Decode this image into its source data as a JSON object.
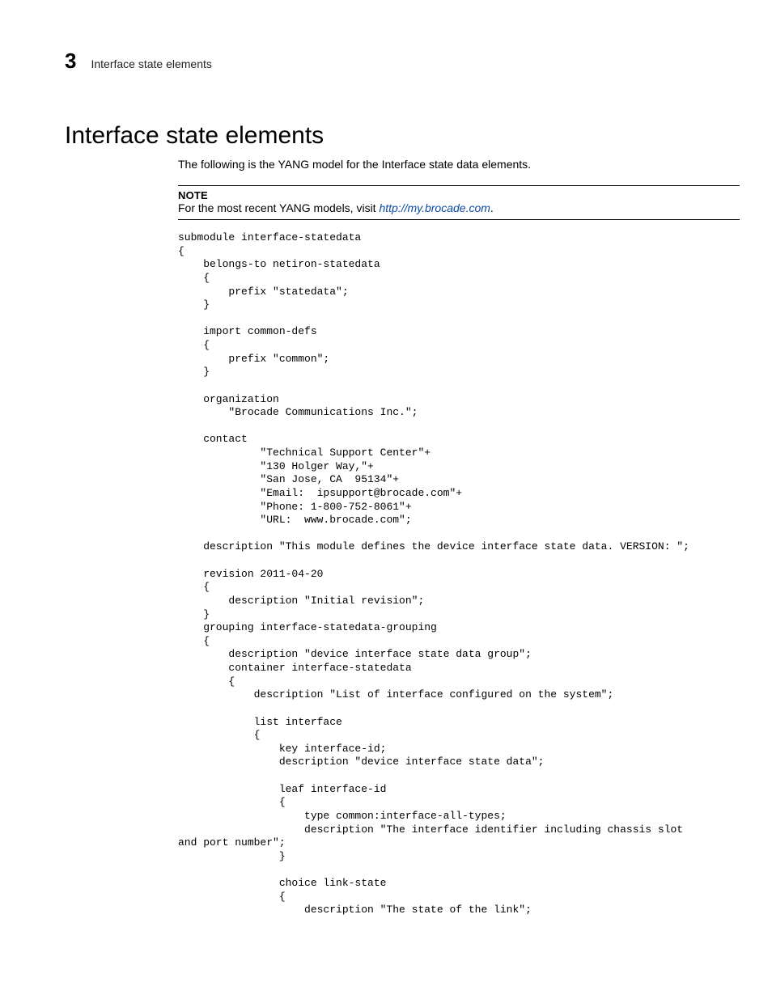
{
  "header": {
    "chapter_number": "3",
    "running_title": "Interface state elements"
  },
  "section": {
    "title": "Interface state elements",
    "intro": "The following is the YANG model for the Interface state data elements."
  },
  "note": {
    "label": "NOTE",
    "text_prefix": "For the most recent YANG models, visit ",
    "link_text": "http://my.brocade.com",
    "text_suffix": "."
  },
  "code": "submodule interface-statedata\n{\n    belongs-to netiron-statedata\n    {\n        prefix \"statedata\";\n    }\n\n    import common-defs\n    {\n        prefix \"common\";\n    }\n\n    organization\n        \"Brocade Communications Inc.\";\n\n    contact\n             \"Technical Support Center\"+\n             \"130 Holger Way,\"+\n             \"San Jose, CA  95134\"+\n             \"Email:  ipsupport@brocade.com\"+\n             \"Phone: 1-800-752-8061\"+\n             \"URL:  www.brocade.com\";\n\n    description \"This module defines the device interface state data. VERSION: \";\n\n    revision 2011-04-20\n    {\n        description \"Initial revision\";\n    }\n    grouping interface-statedata-grouping\n    {\n        description \"device interface state data group\";\n        container interface-statedata\n        {\n            description \"List of interface configured on the system\";\n\n            list interface\n            {\n                key interface-id;\n                description \"device interface state data\";\n\n                leaf interface-id\n                {\n                    type common:interface-all-types;\n                    description \"The interface identifier including chassis slot\nand port number\";\n                }\n\n                choice link-state\n                {\n                    description \"The state of the link\";"
}
